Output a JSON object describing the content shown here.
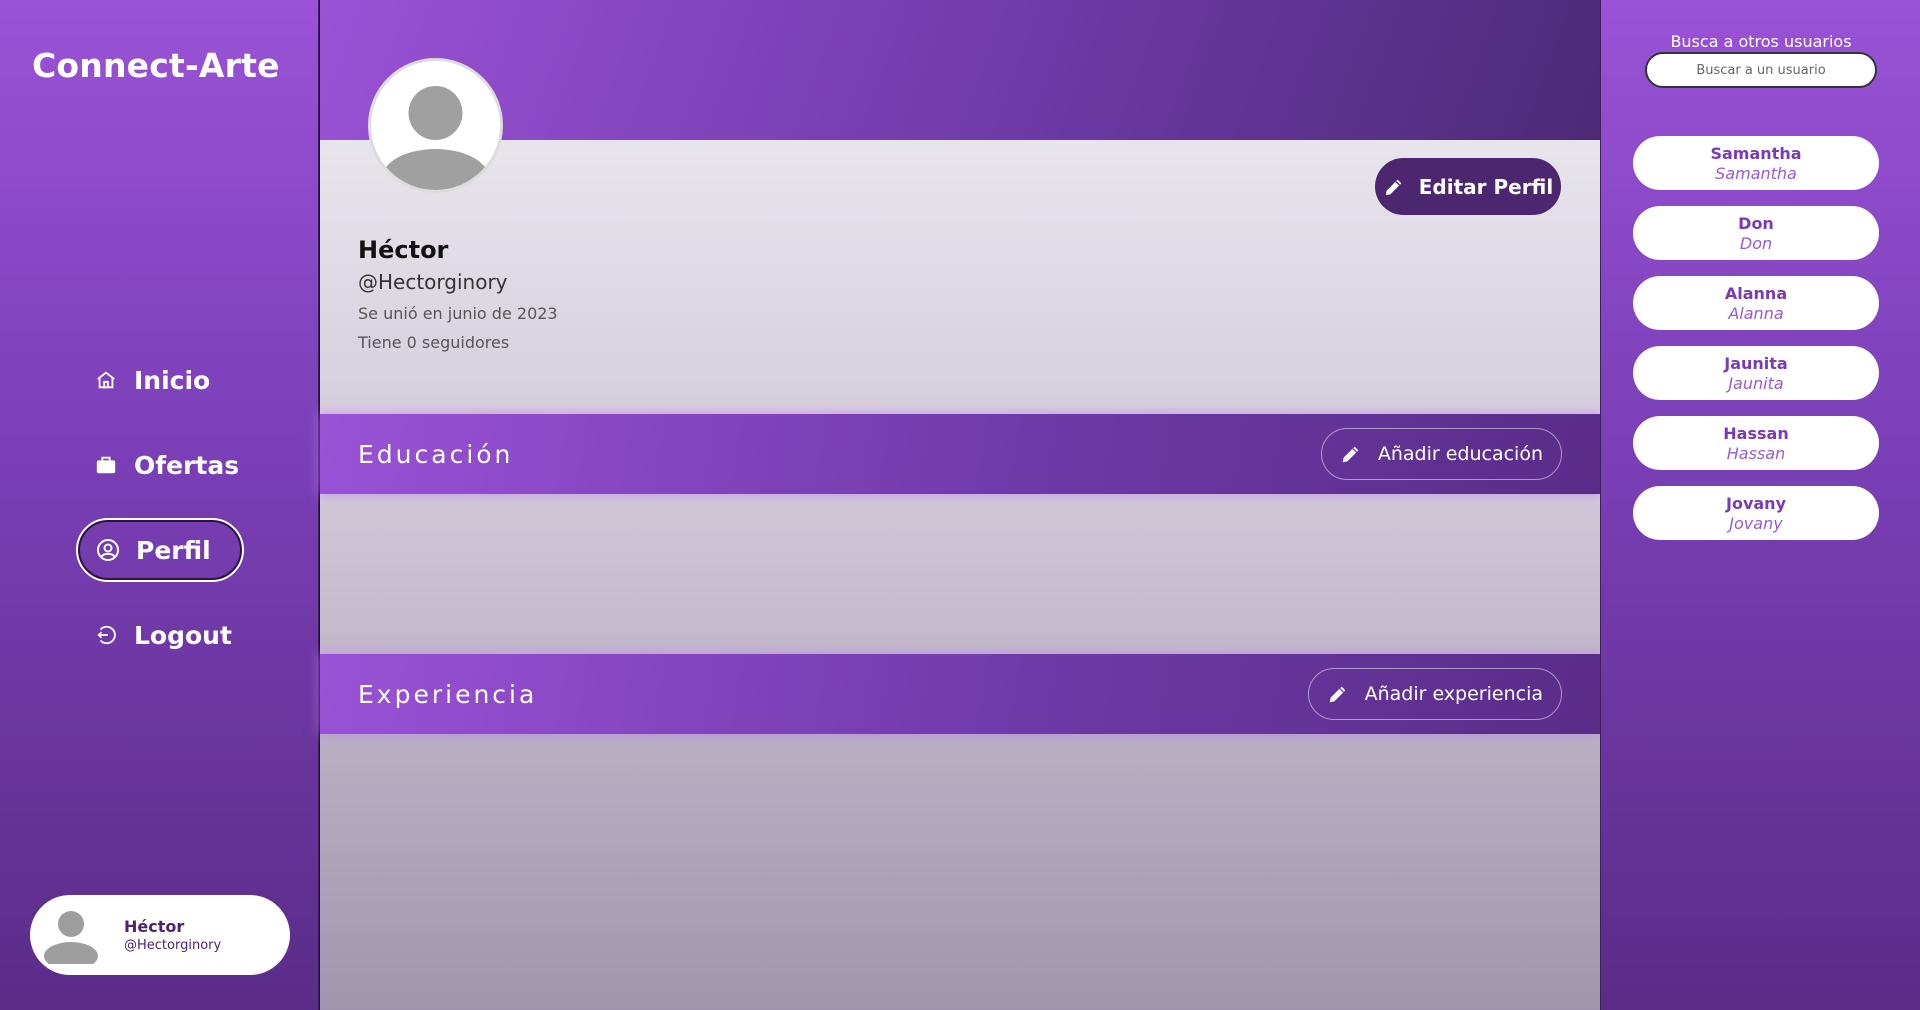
{
  "brand": "Connect-Arte",
  "nav": {
    "items": [
      {
        "label": "Inicio",
        "icon": "home-icon"
      },
      {
        "label": "Ofertas",
        "icon": "briefcase-icon"
      },
      {
        "label": "Perfil",
        "icon": "user-circle-icon",
        "active": true
      },
      {
        "label": "Logout",
        "icon": "logout-icon"
      }
    ]
  },
  "current_user": {
    "name": "Héctor",
    "handle": "@Hectorginory"
  },
  "profile": {
    "name": "Héctor",
    "handle": "@Hectorginory",
    "joined": "Se unió en junio de 2023",
    "followers": "Tiene 0 seguidores",
    "edit_label": "Editar Perfil"
  },
  "sections": {
    "education": {
      "title": "Educación",
      "button": "Añadir educación"
    },
    "experience": {
      "title": "Experiencia",
      "button": "Añadir experiencia"
    }
  },
  "right_panel": {
    "title": "Busca a otros usuarios",
    "search_placeholder": "Buscar a un usuario",
    "users": [
      {
        "name": "Samantha",
        "handle": "Samantha"
      },
      {
        "name": "Don",
        "handle": "Don"
      },
      {
        "name": "Alanna",
        "handle": "Alanna"
      },
      {
        "name": "Jaunita",
        "handle": "Jaunita"
      },
      {
        "name": "Hassan",
        "handle": "Hassan"
      },
      {
        "name": "Jovany",
        "handle": "Jovany"
      }
    ]
  },
  "colors": {
    "purple_light": "#9a52d6",
    "purple_dark": "#4d2670",
    "white": "#ffffff"
  }
}
